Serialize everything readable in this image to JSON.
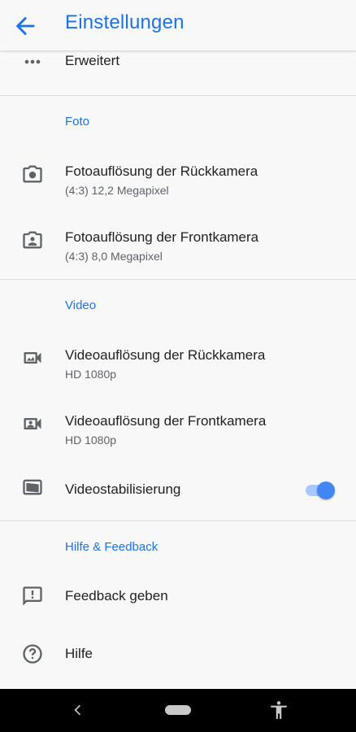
{
  "header": {
    "title": "Einstellungen",
    "back_icon": "arrow-back-icon"
  },
  "advanced": {
    "label": "Erweitert",
    "icon": "more-horiz-icon"
  },
  "sections": {
    "photo": {
      "header": "Foto",
      "rear": {
        "title": "Fotoauflösung der Rückkamera",
        "value": "(4:3) 12,2 Megapixel",
        "icon": "camera-rear-icon"
      },
      "front": {
        "title": "Fotoauflösung der Frontkamera",
        "value": "(4:3) 8,0 Megapixel",
        "icon": "camera-front-icon"
      }
    },
    "video": {
      "header": "Video",
      "rear": {
        "title": "Videoauflösung der Rückkamera",
        "value": "HD 1080p",
        "icon": "video-rear-icon"
      },
      "front": {
        "title": "Videoauflösung der Frontkamera",
        "value": "HD 1080p",
        "icon": "video-front-icon"
      },
      "stabilization": {
        "title": "Videostabilisierung",
        "enabled": true,
        "icon": "video-stabilization-icon"
      }
    },
    "help": {
      "header": "Hilfe & Feedback",
      "feedback": {
        "title": "Feedback geben",
        "icon": "feedback-icon"
      },
      "help": {
        "title": "Hilfe",
        "icon": "help-icon"
      }
    }
  },
  "colors": {
    "accent": "#1a73e8",
    "toggle_thumb": "#4285f4",
    "toggle_track": "#a8c7fa",
    "background": "#f8f8f8"
  },
  "navbar": {
    "back_icon": "nav-back-icon",
    "home_icon": "nav-home-pill",
    "accessibility_icon": "accessibility-icon"
  }
}
